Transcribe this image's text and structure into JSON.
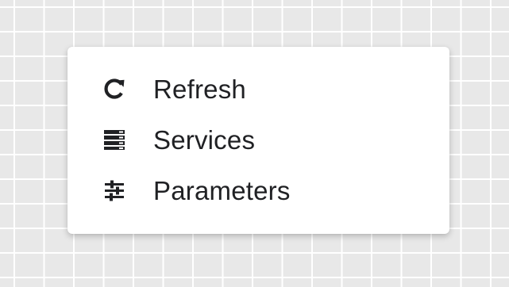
{
  "menu": {
    "items": [
      {
        "label": "Refresh",
        "icon": "refresh-icon"
      },
      {
        "label": "Services",
        "icon": "services-list-icon"
      },
      {
        "label": "Parameters",
        "icon": "sliders-icon"
      }
    ]
  },
  "colors": {
    "background": "#e8e8e8",
    "grid_line": "#ffffff",
    "menu_bg": "#ffffff",
    "text": "#202124",
    "icon": "#202124"
  }
}
